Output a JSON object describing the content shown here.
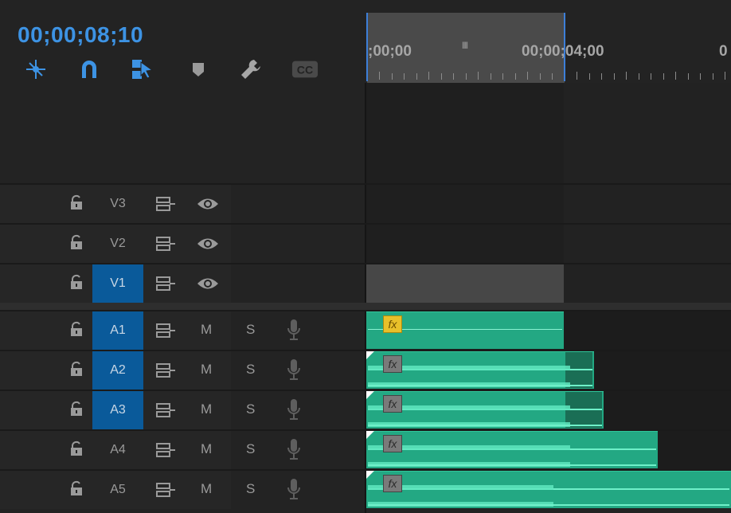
{
  "timecode": "00;00;08;10",
  "ruler": {
    "labels": [
      ";00;00",
      "00;00;04;00",
      "0"
    ],
    "grip": "III"
  },
  "toolbar": {
    "tools": [
      {
        "name": "insert-overwrite-icon"
      },
      {
        "name": "snap-magnet-icon"
      },
      {
        "name": "linked-selection-icon"
      },
      {
        "name": "add-marker-icon"
      },
      {
        "name": "wrench-settings-icon"
      },
      {
        "name": "captions-cc-icon",
        "label": "CC"
      }
    ]
  },
  "video_tracks": [
    {
      "name": "V3",
      "active": false
    },
    {
      "name": "V2",
      "active": false
    },
    {
      "name": "V1",
      "active": true
    }
  ],
  "audio_tracks": [
    {
      "name": "A1",
      "active": true,
      "mute": "M",
      "solo": "S"
    },
    {
      "name": "A2",
      "active": true,
      "mute": "M",
      "solo": "S"
    },
    {
      "name": "A3",
      "active": true,
      "mute": "M",
      "solo": "S"
    },
    {
      "name": "A4",
      "active": false,
      "mute": "M",
      "solo": "S"
    },
    {
      "name": "A5",
      "active": false,
      "mute": "M",
      "solo": "S"
    }
  ],
  "fx_label": "fx",
  "colors": {
    "accent_blue": "#3d93e4",
    "track_active": "#0a5a9a",
    "audio_clip": "#23a883",
    "fx_yellow": "#e8c02a"
  }
}
